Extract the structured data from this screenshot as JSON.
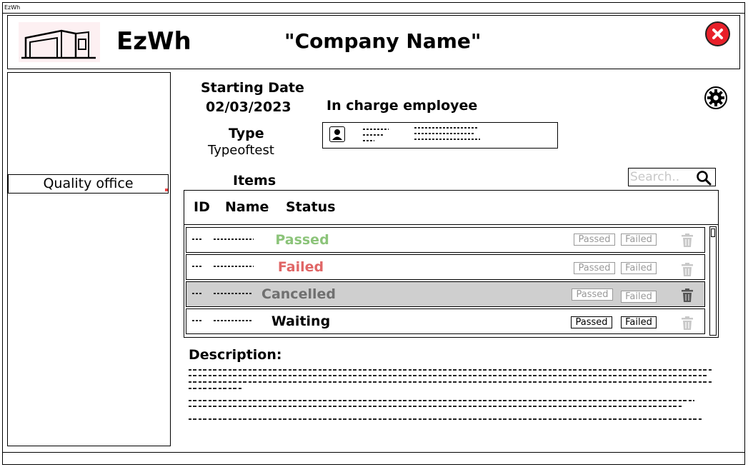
{
  "window": {
    "title": "EzWh"
  },
  "header": {
    "app_name": "EzWh",
    "company": "\"Company Name\""
  },
  "sidebar": {
    "items": [
      {
        "label": "Quality office"
      }
    ]
  },
  "test": {
    "start_label": "Starting Date",
    "start_value": "02/03/2023",
    "type_label": "Type",
    "type_value": "Typeoftest",
    "employee_label": "In charge employee"
  },
  "items": {
    "label": "Items",
    "search_placeholder": "Search..",
    "columns": [
      "ID",
      "Name",
      "Status"
    ],
    "rows": [
      {
        "status": "Passed",
        "color": "#8cc47a",
        "passed_label": "Passed",
        "failed_label": "Failed"
      },
      {
        "status": "Failed",
        "color": "#e06666",
        "passed_label": "Passed",
        "failed_label": "Failed"
      },
      {
        "status": "Cancelled",
        "color": "#707070",
        "passed_label": "Passed",
        "failed_label": "Failed"
      },
      {
        "status": "Waiting",
        "color": "#000000",
        "passed_label": "Passed",
        "failed_label": "Failed"
      }
    ]
  },
  "description": {
    "label": "Description:"
  },
  "icons": [
    "close-icon",
    "gear-icon",
    "search-icon",
    "user-icon",
    "trash-icon",
    "warehouse-logo"
  ]
}
